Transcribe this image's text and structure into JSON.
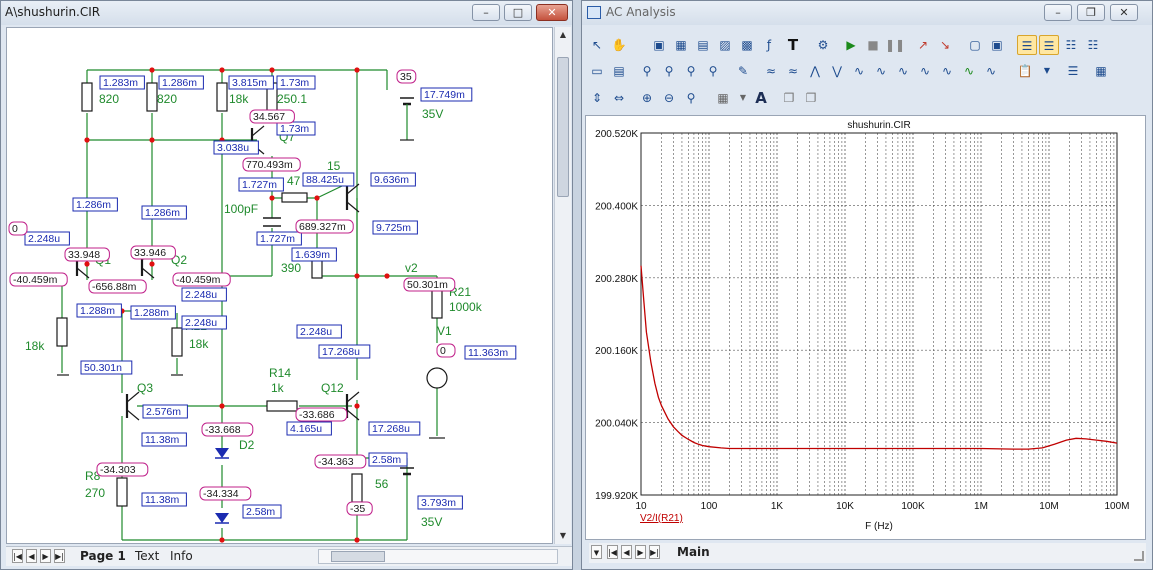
{
  "left_window": {
    "title": "A\\shushurin.CIR",
    "tabs": [
      "Page 1",
      "Text",
      "Info"
    ],
    "components": [
      {
        "id": "r820a",
        "label": "820"
      },
      {
        "id": "r820b",
        "label": "820"
      },
      {
        "id": "r18k_top",
        "label": "18k"
      },
      {
        "id": "r250",
        "label": "250.1"
      },
      {
        "id": "q7",
        "label": "Q7"
      },
      {
        "id": "v35_top",
        "label": "35V"
      },
      {
        "id": "c100p",
        "label": "100pF"
      },
      {
        "id": "r47",
        "label": "47"
      },
      {
        "id": "r15",
        "label": "15"
      },
      {
        "id": "r390",
        "label": "390"
      },
      {
        "id": "q1",
        "label": "Q1"
      },
      {
        "id": "q2",
        "label": "Q2"
      },
      {
        "id": "r18k_left",
        "label": "18k"
      },
      {
        "id": "r22",
        "label": "R22"
      },
      {
        "id": "r18k_r22",
        "label": "18k"
      },
      {
        "id": "v2",
        "label": "v2"
      },
      {
        "id": "r21",
        "label": "R21"
      },
      {
        "id": "r21val",
        "label": "1000k"
      },
      {
        "id": "v1",
        "label": "V1"
      },
      {
        "id": "q3",
        "label": "Q3"
      },
      {
        "id": "r14",
        "label": "R14"
      },
      {
        "id": "r14val",
        "label": "1k"
      },
      {
        "id": "q12",
        "label": "Q12"
      },
      {
        "id": "d2",
        "label": "D2"
      },
      {
        "id": "r8",
        "label": "R8"
      },
      {
        "id": "r8val",
        "label": "270"
      },
      {
        "id": "r56",
        "label": "56"
      },
      {
        "id": "v35_bot",
        "label": "35V"
      }
    ],
    "currents": [
      "1.283m",
      "1.286m",
      "3.815m",
      "1.73m",
      "17.749m",
      "1.73m",
      "3.038u",
      "1.727m",
      "88.425u",
      "9.636m",
      "1.286m",
      "1.286m",
      "1.727m",
      "9.725m",
      "2.248u",
      "1.639m",
      "1.288m",
      "1.288m",
      "2.248u",
      "2.248u",
      "2.248u",
      "17.268u",
      "11.363m",
      "50.301n",
      "2.576m",
      "4.165u",
      "17.268u",
      "11.38m",
      "2.58m",
      "11.38m",
      "2.58m",
      "3.793m",
      "17.754m"
    ],
    "voltages": [
      "35",
      "34.567",
      "770.493m",
      "689.327m",
      "0",
      "33.948",
      "33.946",
      "-40.459m",
      "-656.88m",
      "-40.459m",
      "50.301m",
      "0",
      "-33.668",
      "-33.686",
      "-34.363",
      "-34.303",
      "-34.334",
      "-35"
    ]
  },
  "right_window": {
    "title": "AC Analysis",
    "tabs": [
      "Main"
    ],
    "chart_data": {
      "type": "line",
      "title": "shushurin.CIR",
      "xlabel": "F (Hz)",
      "x_scale": "log",
      "xlim": [
        10,
        100000000
      ],
      "ylim": [
        199920,
        200520
      ],
      "x_ticks": [
        "10",
        "100",
        "1K",
        "10K",
        "100K",
        "1M",
        "10M",
        "100M"
      ],
      "y_ticks": [
        "200.520K",
        "200.400K",
        "200.280K",
        "200.160K",
        "200.040K",
        "199.920K"
      ],
      "series": [
        {
          "name": "V2/I(R21)",
          "color": "#c00000",
          "x": [
            10,
            11,
            12,
            14,
            16,
            18,
            20,
            25,
            30,
            35,
            40,
            50,
            60,
            70,
            80,
            100,
            150,
            200,
            400,
            1000,
            10000,
            100000,
            1000000,
            3000000,
            5000000,
            8000000,
            12000000,
            18000000,
            25000000,
            35000000,
            50000000,
            70000000,
            100000000
          ],
          "y": [
            200300,
            200242,
            200190,
            200140,
            200105,
            200082,
            200068,
            200046,
            200033,
            200025,
            200019,
            200012,
            200007,
            200004,
            200002,
            200000,
            199998,
            199997,
            199997,
            199997,
            199997,
            199997,
            199997,
            199996,
            199996,
            199998,
            200004,
            200011,
            200014,
            200013,
            200011,
            200009,
            200006
          ]
        }
      ]
    }
  }
}
